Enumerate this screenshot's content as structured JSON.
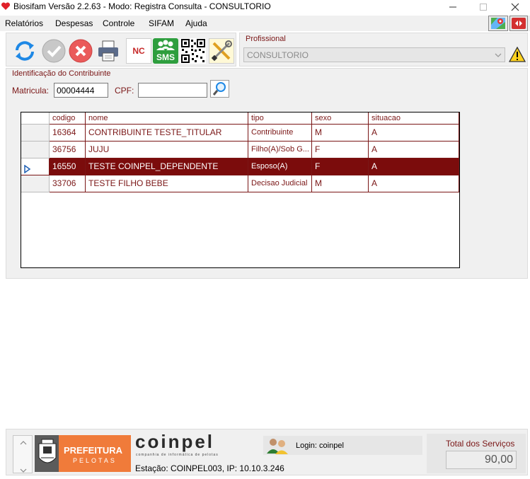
{
  "window": {
    "title": "Biosifam Versão 2.2.63 - Modo: Registra Consulta - CONSULTORIO"
  },
  "menu": [
    "Relatórios",
    "Despesas",
    "Controle",
    "SIFAM",
    "Ajuda"
  ],
  "toolbar": {
    "nc_label": "NC",
    "sms_label": "SMS"
  },
  "profissional": {
    "label": "Profissional",
    "selected": "CONSULTORIO"
  },
  "contribuinte": {
    "group_label": "Identificação do Contribuinte",
    "matricula_label": "Matricula:",
    "matricula_value": "00004444",
    "cpf_label": "CPF:",
    "cpf_value": ""
  },
  "grid": {
    "columns": [
      "codigo",
      "nome",
      "tipo",
      "sexo",
      "situacao"
    ],
    "rows": [
      {
        "codigo": "16364",
        "nome": "CONTRIBUINTE TESTE_TITULAR",
        "tipo": "Contribuinte",
        "sexo": "M",
        "situacao": "A",
        "selected": false
      },
      {
        "codigo": "36756",
        "nome": "JUJU",
        "tipo": "Filho(A)/Sob G...",
        "sexo": "F",
        "situacao": "A",
        "selected": false
      },
      {
        "codigo": "16550",
        "nome": "TESTE COINPEL_DEPENDENTE",
        "tipo": "Esposo(A)",
        "sexo": "F",
        "situacao": "A",
        "selected": true
      },
      {
        "codigo": "33706",
        "nome": "TESTE FILHO BEBE",
        "tipo": "Decisao Judicial",
        "sexo": "M",
        "situacao": "A",
        "selected": false
      }
    ]
  },
  "status": {
    "prefeitura_line1": "PREFEITURA",
    "prefeitura_line2": "PELOTAS",
    "coinpel_logo": "coinpel",
    "coinpel_tagline": "companhia de informática de pelotas",
    "login": "Login: coinpel",
    "estacao": "Estação: COINPEL003, IP: 10.10.3.246",
    "total_label": "Total dos Serviços",
    "total_value": "90,00"
  },
  "colors": {
    "accent": "#7b0c0c",
    "label_maroon": "#7a1616",
    "prefeitura_orange": "#f07b3a",
    "sms_green": "#2e9e3e"
  },
  "icons": {
    "app": "heart-icon",
    "refresh": "refresh-icon",
    "confirm": "check-icon",
    "cancel": "cancel-icon",
    "print": "printer-icon",
    "sms": "sms-icon",
    "qr": "qrcode-icon",
    "tools": "tools-icon",
    "warning": "warning-icon",
    "search": "search-icon",
    "login": "users-icon"
  }
}
